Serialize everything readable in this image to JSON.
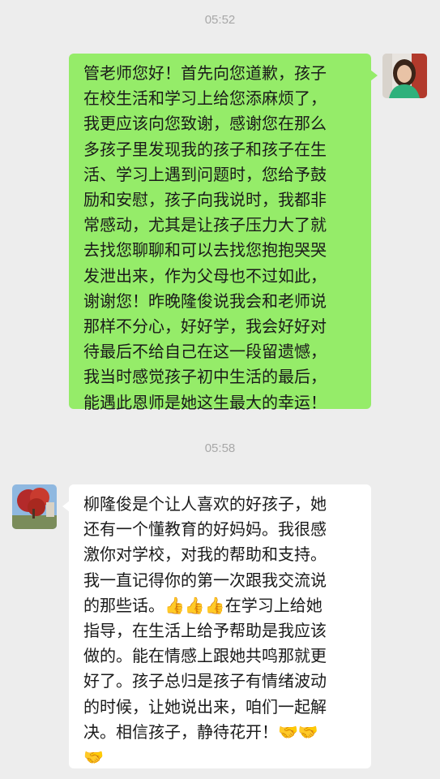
{
  "chat": {
    "timestamps": [
      "05:52",
      "05:58"
    ],
    "messages": [
      {
        "sender": "self",
        "lines": [
          "管老师您好！首先向您道歉，孩子",
          "在校生活和学习上给您添麻烦了，",
          "我更应该向您致谢，感谢您在那么",
          "多孩子里发现我的孩子和孩子在生",
          "活、学习上遇到问题时，您给予鼓",
          "励和安慰，孩子向我说时，我都非",
          "常感动，尤其是让孩子压力大了就",
          "去找您聊聊和可以去找您抱抱哭哭",
          "发泄出来，作为父母也不过如此，",
          "谢谢您！昨晚隆俊说我会和老师说",
          "那样不分心，好好学，我会好好对",
          "待最后不给自己在这一段留遗憾，",
          "我当时感觉孩子初中生活的最后，",
          "能遇此恩师是她这生最大的幸运！"
        ]
      },
      {
        "sender": "other",
        "lines": [
          "柳隆俊是个让人喜欢的好孩子，她",
          "还有一个懂教育的好妈妈。我很感",
          "激你对学校，对我的帮助和支持。",
          "我一直记得你的第一次跟我交流说",
          "的那些话。👍👍👍在学习上给她",
          "指导，在生活上给予帮助是我应该",
          "做的。能在情感上跟她共鸣那就更",
          "好了。孩子总归是孩子有情绪波动",
          "的时候，让她说出来，咱们一起解",
          "决。相信孩子，静待花开！🤝🤝",
          "🤝"
        ]
      }
    ]
  }
}
